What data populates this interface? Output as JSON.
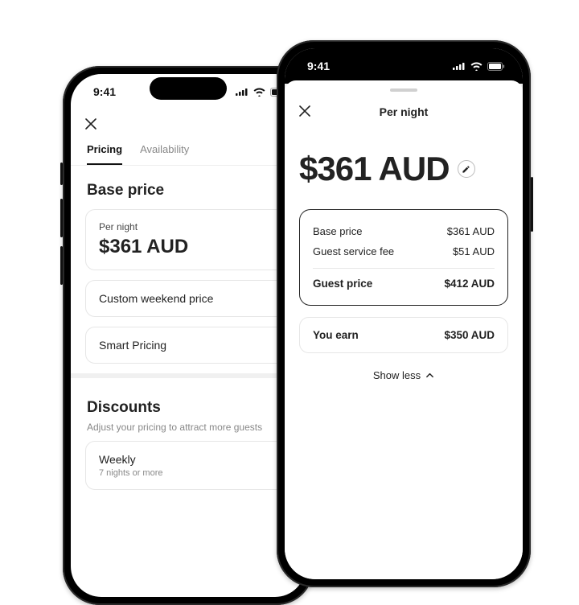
{
  "status": {
    "time": "9:41"
  },
  "left": {
    "tabs": {
      "pricing": "Pricing",
      "availability": "Availability"
    },
    "base": {
      "heading": "Base price",
      "per_night_label": "Per night",
      "per_night_value": "$361 AUD",
      "custom_weekend": "Custom weekend price",
      "smart_pricing": "Smart Pricing"
    },
    "discounts": {
      "heading": "Discounts",
      "subtitle": "Adjust your pricing to attract more guests",
      "weekly_label": "Weekly",
      "weekly_sub": "7 nights or more"
    }
  },
  "right": {
    "title": "Per night",
    "big_price": "$361 AUD",
    "breakdown": {
      "base_label": "Base price",
      "base_value": "$361 AUD",
      "fee_label": "Guest service fee",
      "fee_value": "$51 AUD",
      "guest_label": "Guest price",
      "guest_value": "$412 AUD"
    },
    "earn_label": "You earn",
    "earn_value": "$350 AUD",
    "show_less": "Show less"
  }
}
